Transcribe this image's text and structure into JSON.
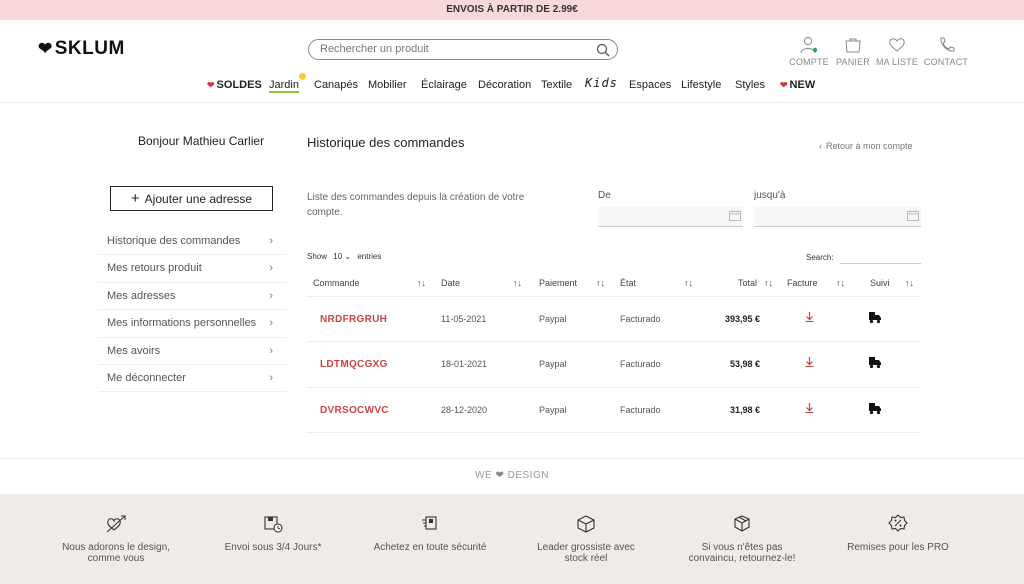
{
  "promo": {
    "text": "ENVOIS À PARTIR DE 2.99€"
  },
  "brand": {
    "name": "SKLUM"
  },
  "search": {
    "placeholder": "Rechercher un produit"
  },
  "header_actions": {
    "compte": "COMPTE",
    "panier": "PANIER",
    "ma_liste": "MA LISTE",
    "contact": "CONTACT"
  },
  "nav": {
    "soldes": "SOLDES",
    "jardin": "Jardin",
    "canapes": "Canapés",
    "mobilier": "Mobilier",
    "eclairage": "Éclairage",
    "decoration": "Décoration",
    "textile": "Textile",
    "kids": "Kids",
    "espaces": "Espaces",
    "lifestyle": "Lifestyle",
    "styles": "Styles",
    "new": "NEW"
  },
  "sidebar": {
    "greeting": "Bonjour Mathieu Carlier",
    "add_address": "Ajouter une adresse",
    "items": [
      {
        "label": "Historique des commandes"
      },
      {
        "label": "Mes retours produit"
      },
      {
        "label": "Mes adresses"
      },
      {
        "label": "Mes informations personnelles"
      },
      {
        "label": "Mes avoirs"
      },
      {
        "label": "Me déconnecter"
      }
    ]
  },
  "main": {
    "title": "Historique des commandes",
    "back_link": "Retour à mon compte",
    "intro": "Liste des commandes depuis la création de votre compte.",
    "date_from_label": "De",
    "date_to_label": "jusqu'à",
    "show_label": "Show",
    "show_value": "10",
    "entries_label": "entries",
    "search_label": "Search:"
  },
  "orders": {
    "columns": {
      "commande": "Commande",
      "date": "Date",
      "paiement": "Paiement",
      "etat": "État",
      "total": "Total",
      "facture": "Facture",
      "suivi": "Suivi"
    },
    "rows": [
      {
        "code": "NRDFRGRUH",
        "date": "11-05-2021",
        "paiement": "Paypal",
        "etat": "Facturado",
        "total": "393,95 €"
      },
      {
        "code": "LDTMQCGXG",
        "date": "18-01-2021",
        "paiement": "Paypal",
        "etat": "Facturado",
        "total": "53,98 €"
      },
      {
        "code": "DVRSOCWVC",
        "date": "28-12-2020",
        "paiement": "Paypal",
        "etat": "Facturado",
        "total": "31,98 €"
      }
    ]
  },
  "footer": {
    "we_design_left": "WE",
    "we_design_right": "DESIGN",
    "features": [
      {
        "label": "Nous adorons le design, comme vous",
        "icon": "heart-arrow-icon"
      },
      {
        "label": "Envoi sous 3/4 Jours*",
        "icon": "shipping-box-icon"
      },
      {
        "label": "Achetez en toute sécurité",
        "icon": "secure-purchase-icon"
      },
      {
        "label": "Leader grossiste avec stock réel",
        "icon": "stock-cube-icon"
      },
      {
        "label": "Si vous n'êtes pas convaincu, retournez-le!",
        "icon": "return-box-icon"
      },
      {
        "label": "Remises pour les PRO",
        "icon": "discount-badge-icon"
      }
    ]
  },
  "colors": {
    "promo_bg": "#f9d8db",
    "order_code": "#cc4444",
    "footer_bg": "#efebe8",
    "nav_heart": "#dd3333",
    "online_dot": "#2ea84f"
  }
}
